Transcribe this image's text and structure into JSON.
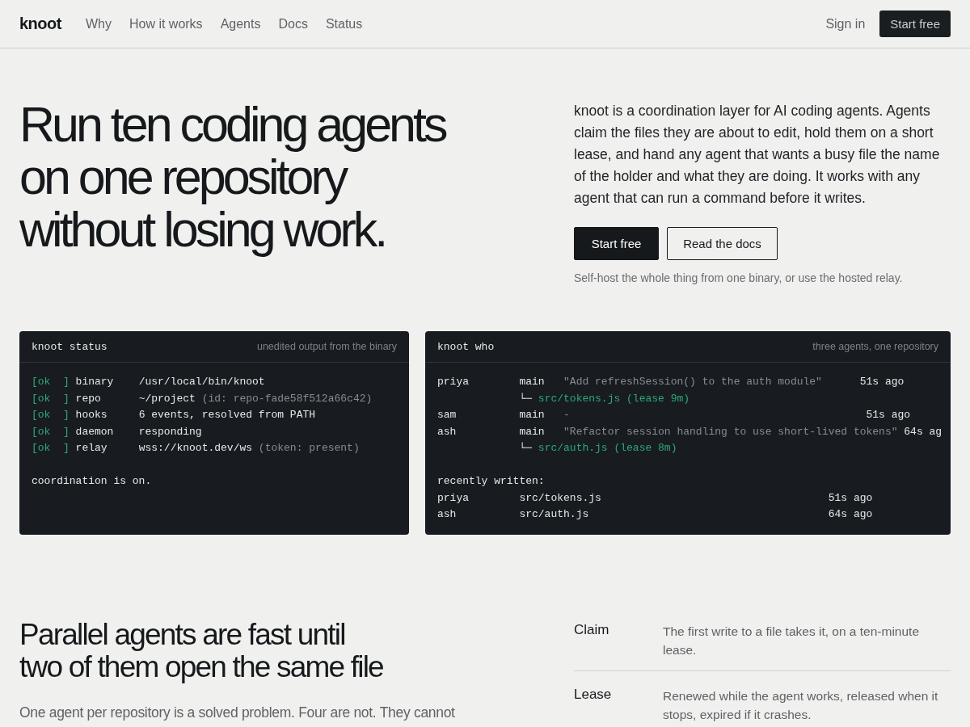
{
  "nav": {
    "logo": "knoot",
    "links": [
      "Why",
      "How it works",
      "Agents",
      "Docs",
      "Status"
    ],
    "sign_in": "Sign in",
    "cta": "Start free"
  },
  "hero": {
    "title_lines": [
      "Run ten coding agents",
      "on one repository",
      "without losing work."
    ],
    "description": "knoot is a coordination layer for AI coding agents. Agents claim the files they are about to edit, hold them on a short lease, and hand any agent that wants a busy file the name of the holder and what they are doing. It works with any agent that can run a command before it writes.",
    "buttons": [
      {
        "label": "Start free",
        "kind": "primary"
      },
      {
        "label": "Read the docs",
        "kind": "secondary"
      }
    ],
    "note": "Self-host the whole thing from one binary, or use the hosted relay."
  },
  "terminals": [
    {
      "command": "knoot status",
      "caption": "unedited output from the binary",
      "blocks": [
        [
          [
            {
              "text": "[ok  ]",
              "kind": "status"
            },
            {
              "text": " binary    /usr/local/bin/knoot",
              "kind": "output"
            }
          ],
          [
            {
              "text": "[ok  ]",
              "kind": "status"
            },
            {
              "text": " repo      ~/project",
              "kind": "output"
            },
            {
              "text": " (id: repo-fade58f512a66c42)",
              "kind": "comment"
            }
          ],
          [
            {
              "text": "[ok  ]",
              "kind": "status"
            },
            {
              "text": " hooks     6 events, resolved from PATH",
              "kind": "output"
            }
          ],
          [
            {
              "text": "[ok  ]",
              "kind": "status"
            },
            {
              "text": " daemon    responding",
              "kind": "output"
            }
          ],
          [
            {
              "text": "[ok  ]",
              "kind": "status"
            },
            {
              "text": " relay     wss://knoot.dev/ws",
              "kind": "output"
            },
            {
              "text": " (token: present)",
              "kind": "comment"
            }
          ]
        ],
        [
          [
            {
              "text": "coordination is on.",
              "kind": "output"
            }
          ]
        ]
      ]
    },
    {
      "command": "knoot who",
      "caption": "three agents, one repository",
      "blocks": [
        [
          [
            {
              "text": "priya        main   ",
              "kind": "output"
            },
            {
              "text": "\"Add refreshSession() to the auth module\"",
              "kind": "comment"
            },
            {
              "text": "      51s ago",
              "kind": "output"
            }
          ],
          [
            {
              "text": "             └─ ",
              "kind": "output"
            },
            {
              "text": "src/tokens.js (lease 9m)",
              "kind": "status"
            }
          ],
          [
            {
              "text": "sam          main   ",
              "kind": "output"
            },
            {
              "text": "-",
              "kind": "comment"
            },
            {
              "text": "                                               51s ago",
              "kind": "output"
            }
          ],
          [
            {
              "text": "ash          main   ",
              "kind": "output"
            },
            {
              "text": "\"Refactor session handling to use short-lived tokens\"",
              "kind": "comment"
            },
            {
              "text": " 64s ag",
              "kind": "output"
            }
          ],
          [
            {
              "text": "             └─ ",
              "kind": "output"
            },
            {
              "text": "src/auth.js (lease 8m)",
              "kind": "status"
            }
          ]
        ],
        [
          [
            {
              "text": "recently written:",
              "kind": "output"
            }
          ],
          [
            {
              "text": "priya        src/tokens.js                                    51s ago",
              "kind": "output"
            }
          ],
          [
            {
              "text": "ash          src/auth.js                                      64s ago",
              "kind": "output"
            }
          ]
        ]
      ]
    }
  ],
  "problem": {
    "title_lines": [
      "Parallel agents are fast until",
      "two of them open the same file"
    ],
    "paragraph": "One agent per repository is a solved problem. Four are not. They cannot",
    "terms": [
      {
        "term": "Claim",
        "definition": "The first write to a file takes it, on a ten-minute lease."
      },
      {
        "term": "Lease",
        "definition": "Renewed while the agent works, released when it stops, expired if it crashes."
      }
    ]
  }
}
